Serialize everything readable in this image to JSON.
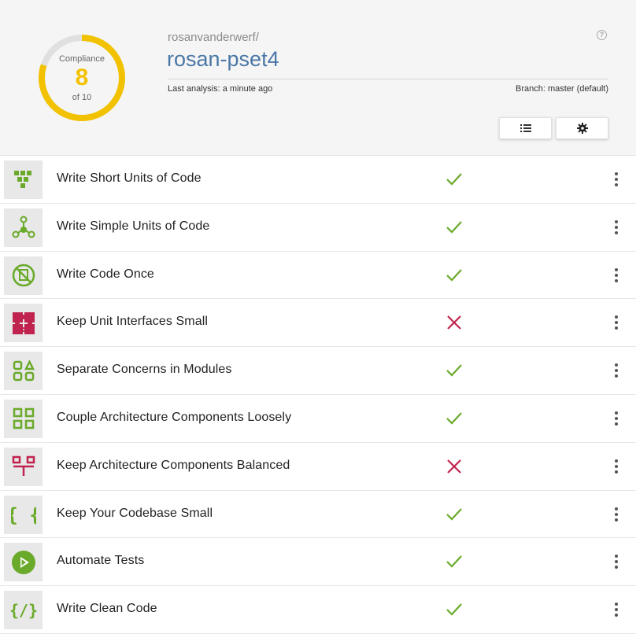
{
  "compliance": {
    "label": "Compliance",
    "value": "8",
    "of_text": "of 10",
    "fraction": 0.8,
    "color": "#f2c200",
    "track_color": "#e0e0e0"
  },
  "repo": {
    "owner": "rosanvanderwerf/",
    "name": "rosan-pset4",
    "last_analysis": "Last analysis: a minute ago",
    "branch": "Branch: master (default)"
  },
  "help_icon": "help-circle-icon",
  "toolbar": {
    "list_icon": "list-icon",
    "settings_icon": "gear-icon"
  },
  "colors": {
    "pass": "#6aaa2a",
    "fail": "#c0234e",
    "icon_green": "#6aaa2a",
    "icon_red": "#c0234e",
    "link": "#4a77a6"
  },
  "guidelines": [
    {
      "label": "Write Short Units of Code",
      "status": "pass",
      "icon": "short-units-icon"
    },
    {
      "label": "Write Simple Units of Code",
      "status": "pass",
      "icon": "simple-units-icon"
    },
    {
      "label": "Write Code Once",
      "status": "pass",
      "icon": "code-once-icon"
    },
    {
      "label": "Keep Unit Interfaces Small",
      "status": "fail",
      "icon": "puzzle-icon"
    },
    {
      "label": "Separate Concerns in Modules",
      "status": "pass",
      "icon": "modules-icon"
    },
    {
      "label": "Couple Architecture Components Loosely",
      "status": "pass",
      "icon": "loose-coupling-icon"
    },
    {
      "label": "Keep Architecture Components Balanced",
      "status": "fail",
      "icon": "balance-icon"
    },
    {
      "label": "Keep Your Codebase Small",
      "status": "pass",
      "icon": "braces-icon"
    },
    {
      "label": "Automate Tests",
      "status": "pass",
      "icon": "play-icon"
    },
    {
      "label": "Write Clean Code",
      "status": "pass",
      "icon": "clean-code-icon"
    }
  ]
}
